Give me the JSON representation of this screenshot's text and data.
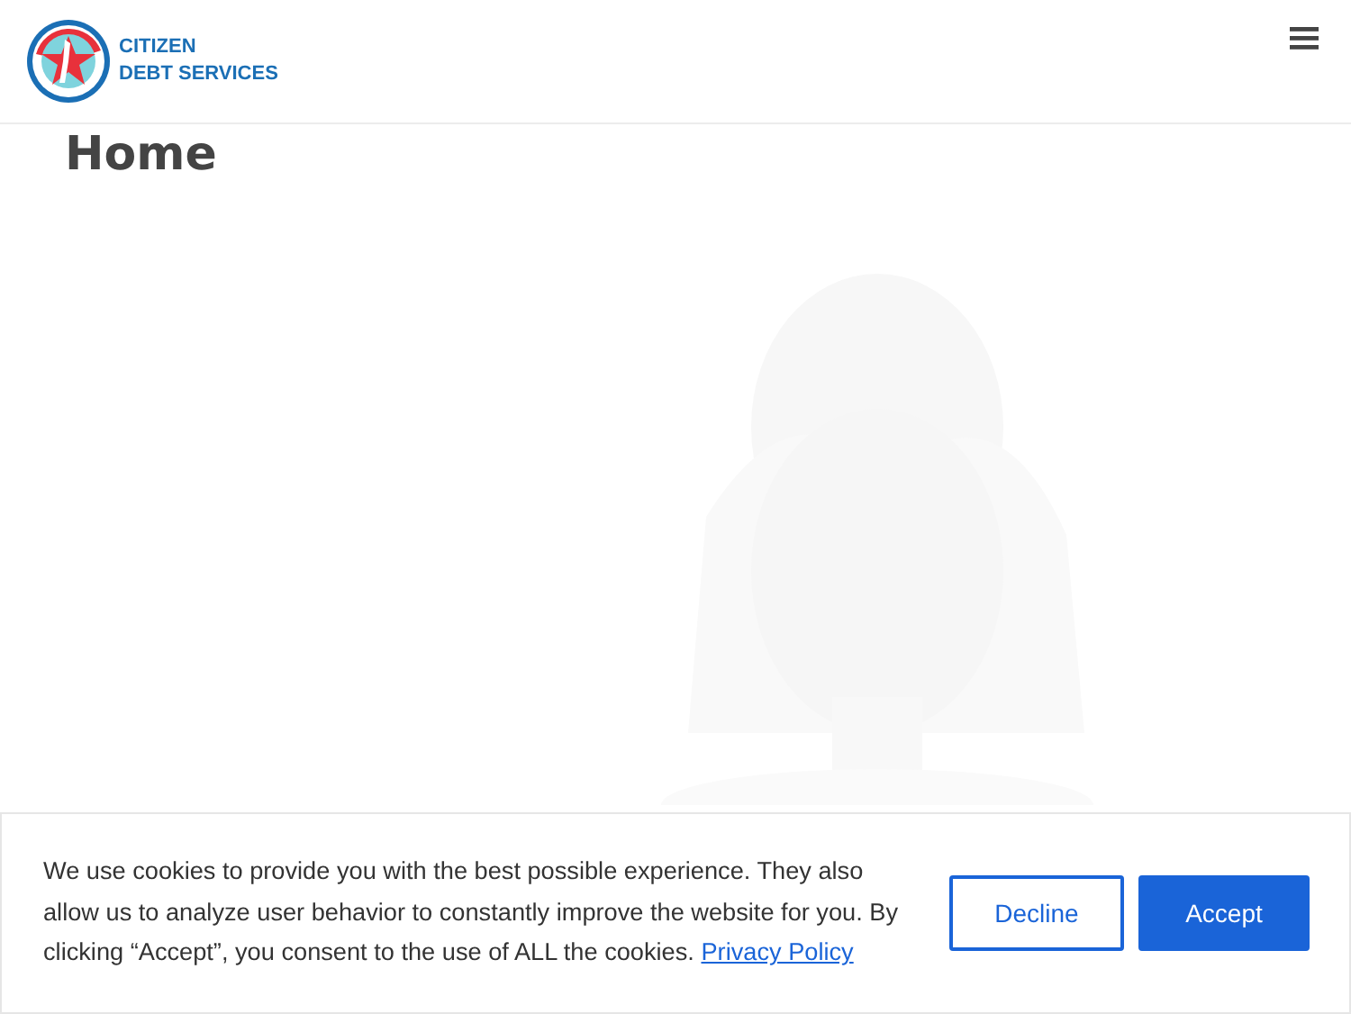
{
  "header": {
    "logo_line_1": "CITIZEN",
    "logo_line_2": "DEBT SERVICES"
  },
  "page": {
    "title": "Home"
  },
  "cookie_banner": {
    "message": "We use cookies to provide you with the best possible experience. They also allow us to analyze user behavior to constantly improve the website for you. By clicking “Accept”, you consent to the use of ALL the cookies.",
    "link": "Privacy Policy",
    "buttons": [
      {
        "label": "Decline",
        "kind": "outline"
      },
      {
        "label": "Accept",
        "kind": "primary"
      }
    ]
  }
}
